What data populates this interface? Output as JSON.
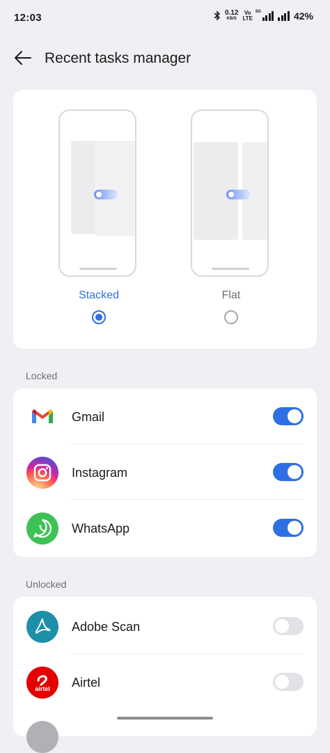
{
  "status_bar": {
    "time": "12:03",
    "net_speed_value": "0.12",
    "net_speed_unit": "KB/S",
    "volte_top": "Vo",
    "volte_bottom": "LTE",
    "volte_sup": "4G",
    "fiveg": "5G",
    "battery": "42%"
  },
  "header": {
    "title": "Recent tasks manager"
  },
  "layout_options": [
    {
      "label": "Stacked",
      "selected": true
    },
    {
      "label": "Flat",
      "selected": false
    }
  ],
  "locked": {
    "label": "Locked",
    "apps": [
      {
        "name": "Gmail",
        "enabled": true
      },
      {
        "name": "Instagram",
        "enabled": true
      },
      {
        "name": "WhatsApp",
        "enabled": true
      }
    ]
  },
  "unlocked": {
    "label": "Unlocked",
    "apps": [
      {
        "name": "Adobe Scan",
        "enabled": false
      },
      {
        "name": "Airtel",
        "enabled": false
      }
    ]
  },
  "icons": {
    "airtel_text": "airtel"
  },
  "colors": {
    "accent": "#2f6fe4",
    "background": "#f0f0f4",
    "card": "#ffffff"
  }
}
